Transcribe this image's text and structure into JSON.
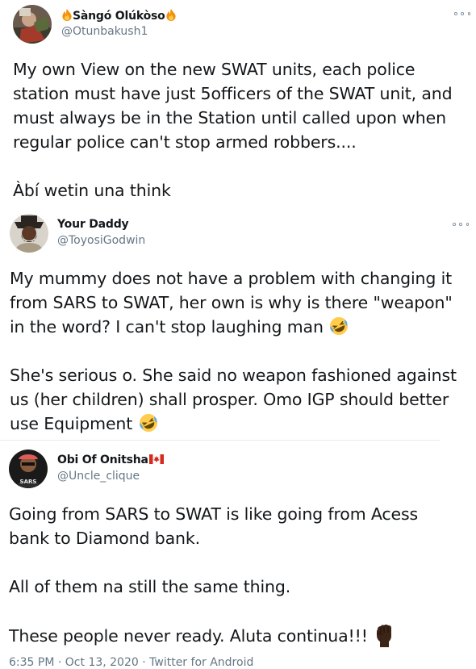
{
  "tweets": [
    {
      "display_name": "Sàngó Olúkòso",
      "handle": "@Otunbakush1",
      "text_lines": [
        "My own View on the new SWAT units, each police",
        "station must have just 5officers of the SWAT unit, and",
        "must always be in the Station until called upon when",
        "regular police can't stop armed robbers....",
        "",
        "Àbí wetin una think"
      ]
    },
    {
      "display_name": "Your Daddy",
      "handle": "@ToyosiGodwin",
      "text_lines": [
        "My mummy does not have a problem with changing it",
        "from SARS to SWAT, her own is why is there \"weapon\"",
        "in the word? I can't stop laughing man",
        "",
        "She's serious o. She said no weapon fashioned against",
        "us (her children) shall prosper. Omo IGP should better",
        "use Equipment"
      ]
    },
    {
      "display_name": "Obi Of Onitsha",
      "handle": "@Uncle_clique",
      "avatar_text": "SARS",
      "text_lines": [
        "Going from SARS to SWAT is like going from Acess",
        "bank to Diamond bank.",
        "",
        "All of them na still the same thing.",
        "",
        "These people never ready. Aluta continua!!!"
      ],
      "footer": {
        "time": "6:35 PM",
        "date": "Oct 13, 2020",
        "source": "Twitter for Android"
      }
    }
  ],
  "icons": {
    "fire": "fire-emoji-icon",
    "rofl": "rolling-on-floor-laughing-emoji-icon",
    "fist": "raised-fist-emoji-icon",
    "flag": "canada-flag-icon",
    "more": "more-options-icon"
  },
  "colors": {
    "text": "#14171a",
    "secondary": "#657786",
    "divider": "#e6ecf0"
  }
}
